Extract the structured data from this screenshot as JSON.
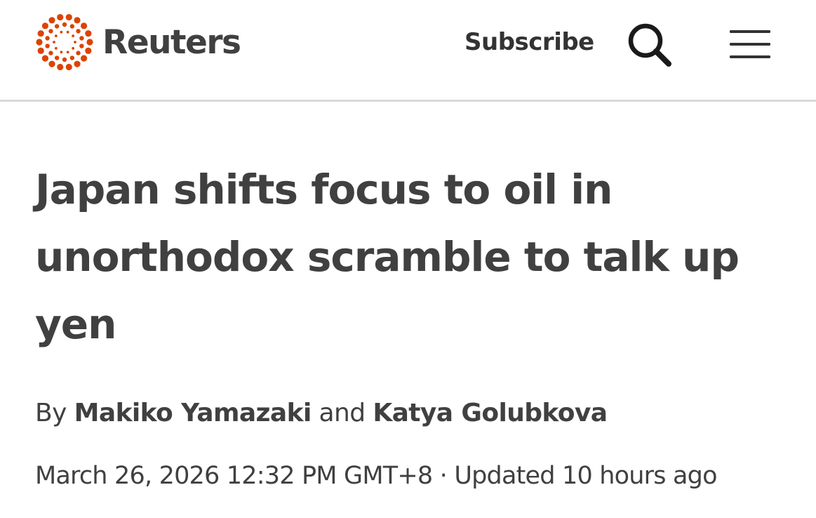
{
  "header": {
    "logo_text": "Reuters",
    "subscribe_label": "Subscribe",
    "search_icon": "search-icon",
    "menu_icon": "hamburger-menu-icon",
    "brand_color": "#dc4300",
    "text_color": "#404040"
  },
  "article": {
    "headline": "Japan shifts focus to oil in unorthodox scramble to talk up yen",
    "byline": {
      "prefix": "By",
      "author_1": "Makiko Yamazaki",
      "conjunction": "and",
      "author_2": "Katya Golubkova"
    },
    "published": "March 26, 2026 12:32 PM GMT+8",
    "separator": "·",
    "updated": "Updated 10 hours ago"
  }
}
